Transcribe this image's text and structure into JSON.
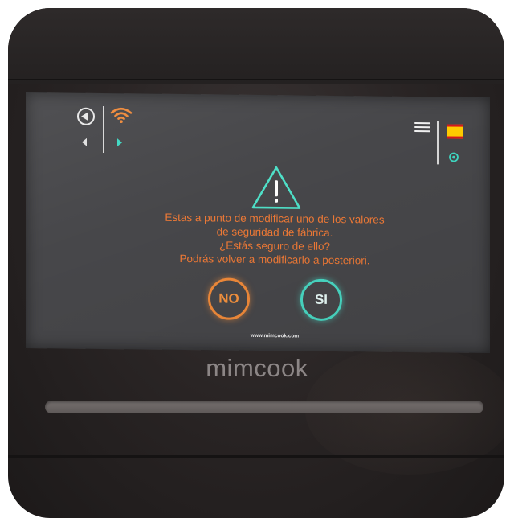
{
  "screen": {
    "top_bar": {
      "back_icon": "back-circle-icon",
      "wifi_icon": "wifi-icon",
      "nav_left_icon": "arrow-left-icon",
      "nav_right_icon": "arrow-right-icon",
      "menu_icon": "hamburger-menu-icon",
      "language_icon": "spain-flag-icon",
      "settings_icon": "settings-icon"
    },
    "dialog": {
      "warning_icon": "warning-triangle-icon",
      "message_lines": [
        "Estas a punto de modificar uno de los valores",
        "de seguridad de fábrica.",
        "¿Estás seguro de ello?",
        "Podrás volver a modificarlo a posteriori."
      ],
      "no_label": "NO",
      "yes_label": "SI"
    },
    "footer_url": "www.mimcook.com"
  },
  "device": {
    "brand": "mimcook"
  },
  "colors": {
    "accent_orange": "#f07a36",
    "accent_teal": "#49d9c4",
    "screen_bg": "#47474a"
  }
}
